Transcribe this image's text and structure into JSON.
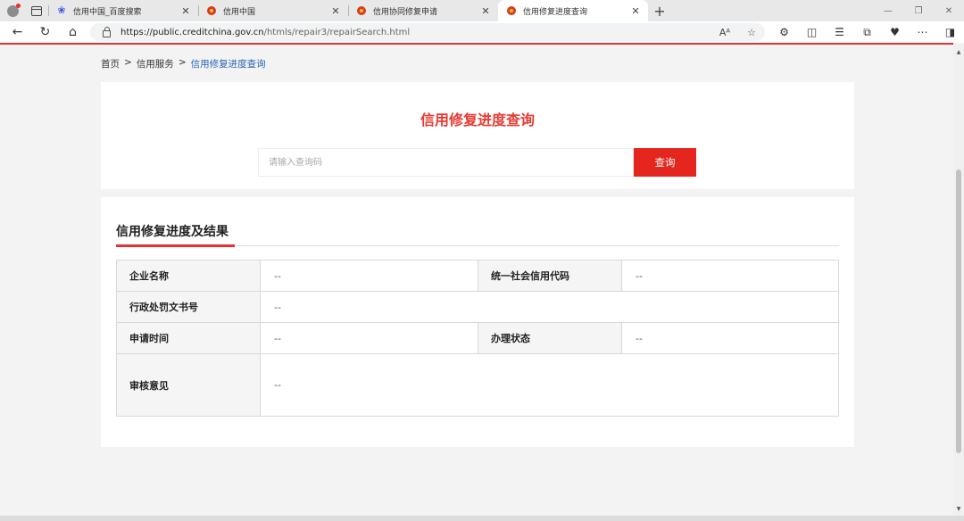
{
  "browser": {
    "tabs": [
      {
        "title": "信用中国_百度搜索",
        "icon": "baidu-paw-icon"
      },
      {
        "title": "信用中国",
        "icon": "national-emblem-icon"
      },
      {
        "title": "信用协同修复申请",
        "icon": "national-emblem-icon"
      },
      {
        "title": "信用修复进度查询",
        "icon": "national-emblem-icon",
        "active": true
      }
    ],
    "url_host": "https://public.creditchina.gov.cn",
    "url_path": "/htmls/repair3/repairSearch.html",
    "accent_color": "#e23232"
  },
  "breadcrumb": {
    "home": "首页",
    "sep1": ">",
    "section": "信用服务",
    "sep2": ">",
    "current": "信用修复进度查询"
  },
  "search": {
    "title": "信用修复进度查询",
    "placeholder": "请输入查询码",
    "button": "查询"
  },
  "result": {
    "title": "信用修复进度及结果",
    "company_label": "企业名称",
    "company_value": "--",
    "credit_code_label": "统一社会信用代码",
    "credit_code_value": "--",
    "penalty_doc_label": "行政处罚文书号",
    "penalty_doc_value": "--",
    "apply_time_label": "申请时间",
    "apply_time_value": "--",
    "status_label": "办理状态",
    "status_value": "--",
    "review_label": "审核意见",
    "review_value": "--"
  }
}
